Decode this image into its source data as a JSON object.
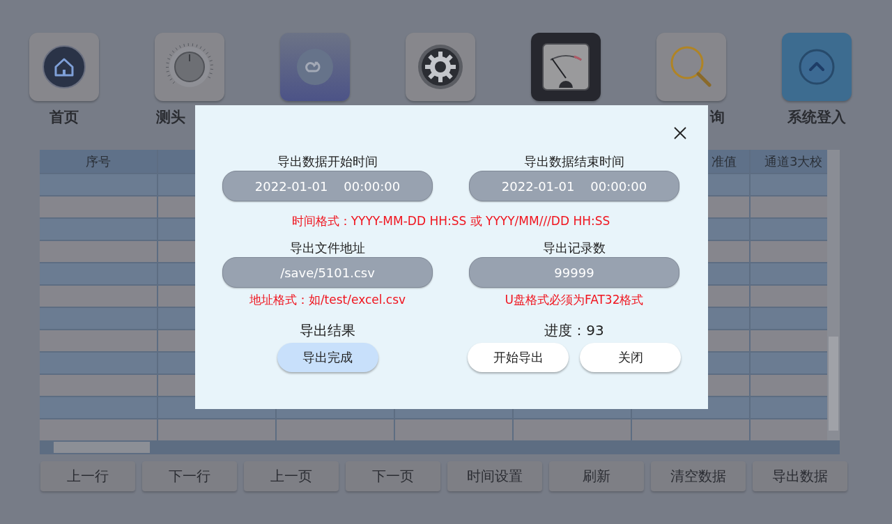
{
  "nav": [
    {
      "kind": "home",
      "label": "首页"
    },
    {
      "kind": "knob",
      "label": "测头"
    },
    {
      "kind": "link"
    },
    {
      "kind": "gear"
    },
    {
      "kind": "meter"
    },
    {
      "kind": "search",
      "label": "询"
    },
    {
      "kind": "up",
      "label": "系统登入"
    }
  ],
  "table": {
    "columns": [
      {
        "label": "序号"
      },
      {},
      {},
      {},
      {},
      {
        "label": "准值"
      },
      {
        "label": "通道3大校"
      }
    ]
  },
  "buttons": [
    "上一行",
    "下一行",
    "上一页",
    "下一页",
    "时间设置",
    "刷新",
    "清空数据",
    "导出数据"
  ],
  "dialog": {
    "start_label": "导出数据开始时间",
    "start_value": "2022-01-01    00:00:00",
    "end_label": "导出数据结束时间",
    "end_value": "2022-01-01    00:00:00",
    "time_hint": "时间格式：YYYY-MM-DD HH:SS 或 YYYY/MM///DD HH:SS",
    "path_label": "导出文件地址",
    "path_value": "/save/5101.csv",
    "path_hint": "地址格式：如/test/excel.csv",
    "count_label": "导出记录数",
    "count_value": "99999",
    "count_hint": "U盘格式必须为FAT32格式",
    "result_label": "导出结果",
    "result_button": "导出完成",
    "progress": "进度：93",
    "start_button": "开始导出",
    "close_button": "关闭"
  }
}
